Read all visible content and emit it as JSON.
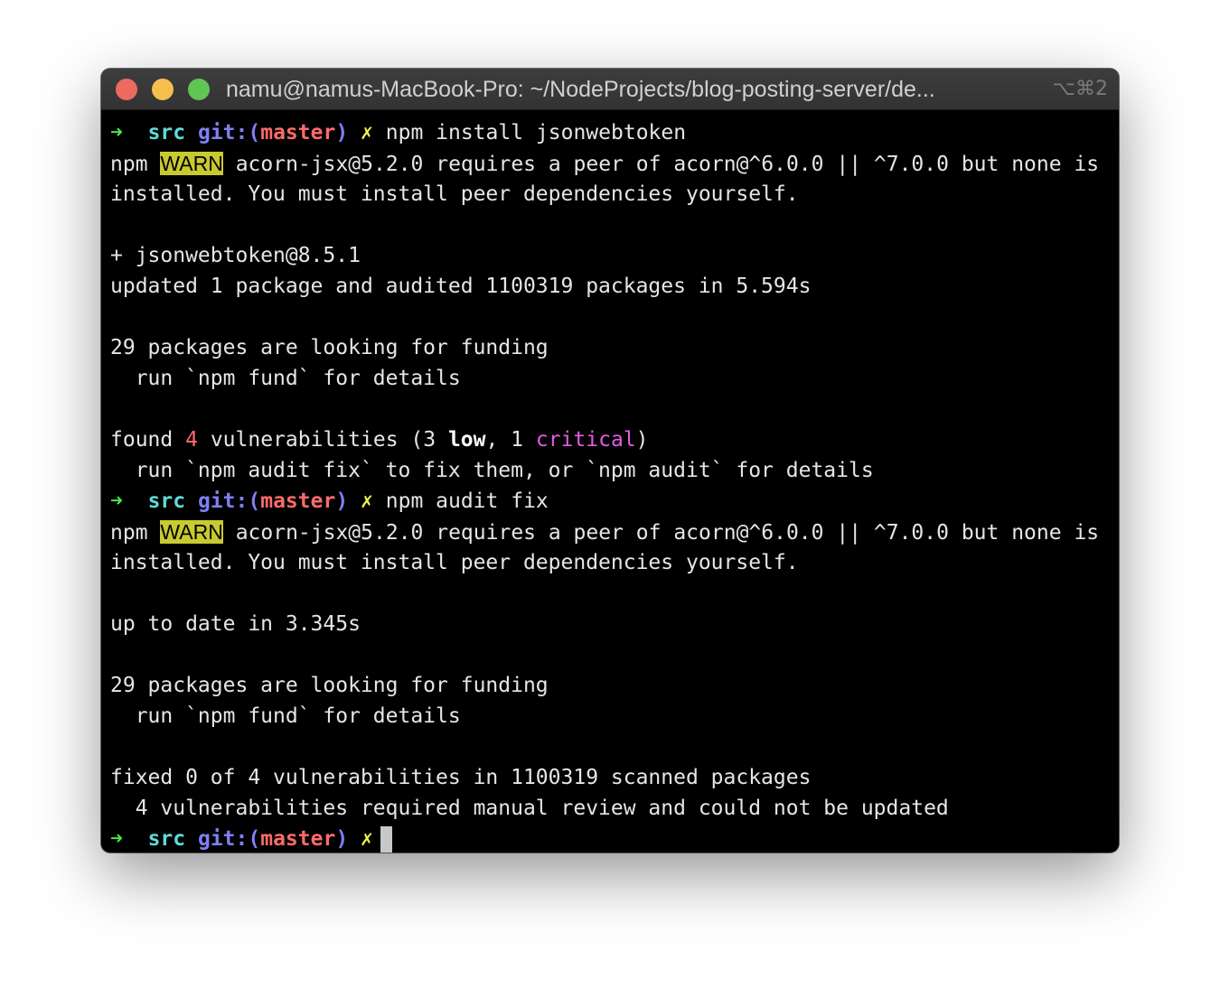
{
  "window": {
    "title": "namu@namus-MacBook-Pro: ~/NodeProjects/blog-posting-server/de...",
    "shortcut": "⌥⌘2"
  },
  "prompt": {
    "arrow": "➜",
    "dir": "src",
    "git": "git:(",
    "branch": "master",
    "git_close": ")",
    "dirty": "✗"
  },
  "terminal": {
    "cmd1": "npm install jsonwebtoken",
    "warn_prefix": "npm",
    "warn_label": "WARN",
    "warn_text": "acorn-jsx@5.2.0 requires a peer of acorn@^6.0.0 || ^7.0.0 but none is",
    "warn_cont": "installed. You must install peer dependencies yourself.",
    "added_pkg": "+ jsonwebtoken@8.5.1",
    "updated": "updated 1 package and audited 1100319 packages in 5.594s",
    "funding": "29 packages are looking for funding",
    "funding_hint": "  run `npm fund` for details",
    "found_prefix": "found",
    "found_count": "4",
    "found_mid": "vulnerabilities (3",
    "found_low": "low",
    "found_sep": ", 1",
    "found_critical": "critical",
    "found_end": ")",
    "audit_hint": "  run `npm audit fix` to fix them, or `npm audit` for details",
    "cmd2": "npm audit fix",
    "uptodate": "up to date in 3.345s",
    "fixed": "fixed 0 of 4 vulnerabilities in 1100319 scanned packages",
    "manual": "  4 vulnerabilities required manual review and could not be updated"
  }
}
